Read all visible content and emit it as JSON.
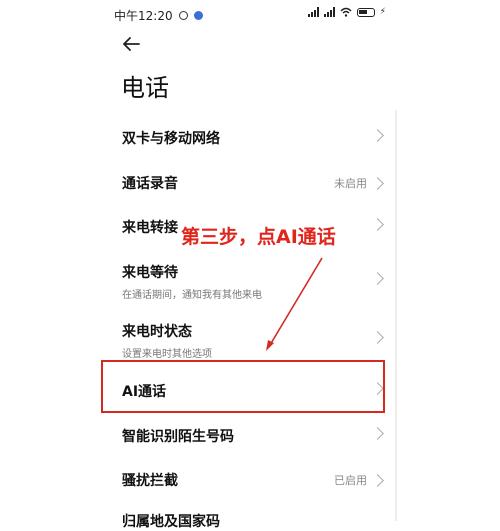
{
  "status_bar": {
    "time": "中午12:20",
    "battery_text": "43"
  },
  "page": {
    "title": "电话"
  },
  "items": [
    {
      "label": "双卡与移动网络",
      "subtitle": "",
      "value": ""
    },
    {
      "label": "通话录音",
      "subtitle": "",
      "value": "未启用"
    },
    {
      "label": "来电转接",
      "subtitle": "",
      "value": ""
    },
    {
      "label": "来电等待",
      "subtitle": "在通话期间，通知我有其他来电",
      "value": ""
    },
    {
      "label": "来电时状态",
      "subtitle": "设置来电时其他选项",
      "value": ""
    },
    {
      "label": "AI通话",
      "subtitle": "",
      "value": ""
    },
    {
      "label": "智能识别陌生号码",
      "subtitle": "",
      "value": ""
    },
    {
      "label": "骚扰拦截",
      "subtitle": "",
      "value": "已启用"
    },
    {
      "label": "归属地及国家码",
      "subtitle": "",
      "value": ""
    }
  ],
  "annotation": {
    "text": "第三步，点AI通话",
    "color": "#e0261c"
  },
  "colors": {
    "accent_red": "#d42a20"
  }
}
